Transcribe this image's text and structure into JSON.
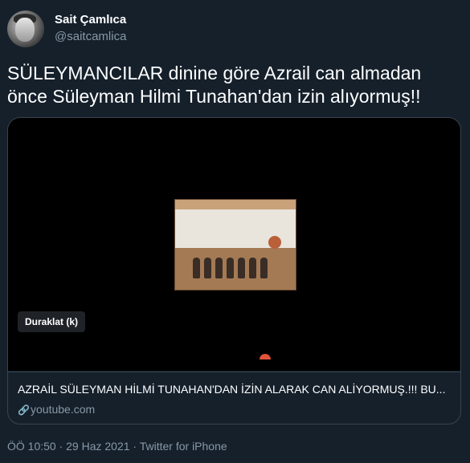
{
  "author": {
    "name": "Sait Çamlıca",
    "handle": "@saitcamlica"
  },
  "tweet": {
    "text": "SÜLEYMANCILAR dinine göre Azrail can almadan önce Süleyman Hilmi Tunahan'dan izin alıyormuş!!"
  },
  "card": {
    "pause_label": "Duraklat (k)",
    "title": "AZRAİL SÜLEYMAN HİLMİ TUNAHAN'DAN İZİN ALARAK CAN ALİYORMUŞ.!!! BU...",
    "link": "youtube.com",
    "link_icon": "link-icon"
  },
  "meta": {
    "timestamp": "ÖÖ 10:50 · 29 Haz 2021 · Twitter for iPhone"
  },
  "colors": {
    "background": "#15202b",
    "secondary_text": "#8899a6",
    "border": "#38444d"
  }
}
